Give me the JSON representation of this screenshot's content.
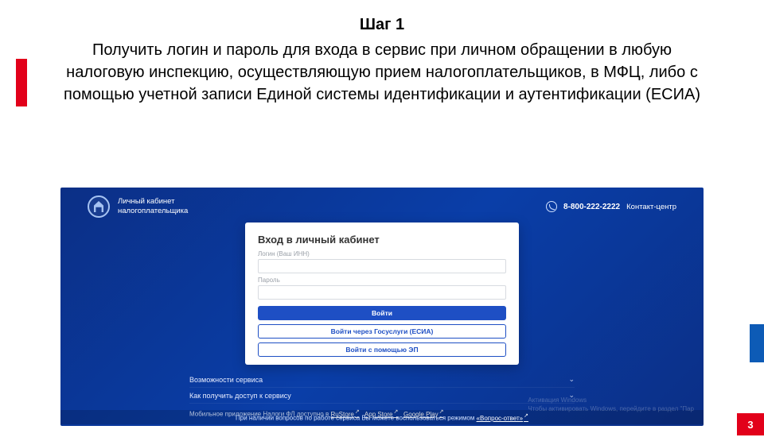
{
  "slide": {
    "step_title": "Шаг 1",
    "step_desc": "Получить логин и пароль для входа в сервис при личном обращении в любую налоговую инспекцию, осуществляющую прием налогоплательщиков, в МФЦ, либо с помощью учетной записи Единой системы идентификации и аутентификации (ЕСИА)",
    "page_number": "3"
  },
  "screenshot": {
    "brand_line1": "Личный кабинет",
    "brand_line2": "налогоплательщика",
    "phone": "8-800-222-2222",
    "phone_label": "Контакт-центр",
    "login": {
      "heading": "Вход в личный кабинет",
      "login_label": "Логин (Ваш ИНН)",
      "password_label": "Пароль",
      "btn_login": "Войти",
      "btn_esia": "Войти через Госуслуги (ЕСИА)",
      "btn_ep": "Войти с помощью ЭП"
    },
    "accordion": {
      "row1": "Возможности сервиса",
      "row2": "Как получить доступ к сервису"
    },
    "mobile": {
      "prefix": "Мобильное приложение Налоги ФЛ доступно в ",
      "link1": "RuStore",
      "link2": "App Store",
      "link3": "Google Play"
    },
    "footer": {
      "prefix": "При наличии вопросов по работе сервиса Вы можете воспользоваться режимом ",
      "link": "«Вопрос-ответ»"
    },
    "watermark": {
      "line1": "Активация Windows",
      "line2": "Чтобы активировать Windows, перейдите в раздел \"Пар"
    }
  }
}
